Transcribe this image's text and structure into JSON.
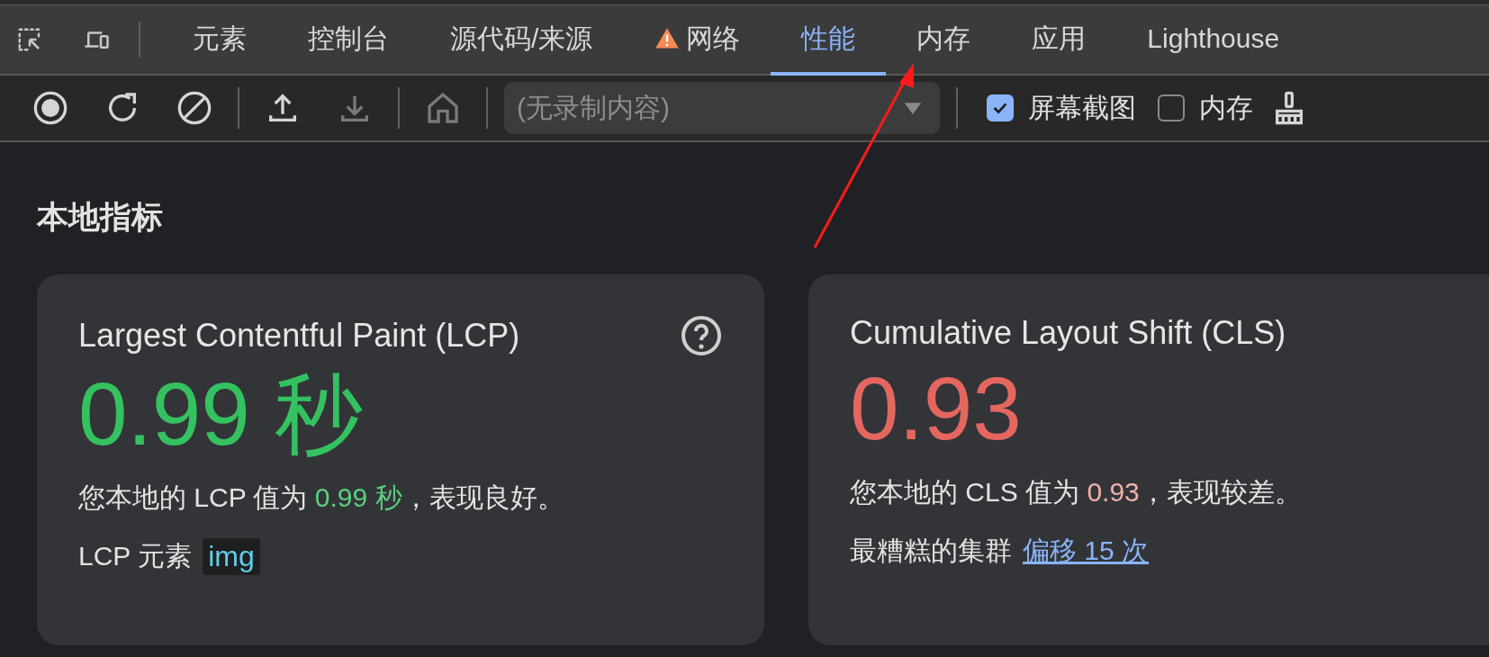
{
  "tabs": [
    {
      "label": "元素",
      "selected": false,
      "warning": false
    },
    {
      "label": "控制台",
      "selected": false,
      "warning": false
    },
    {
      "label": "源代码/来源",
      "selected": false,
      "warning": false
    },
    {
      "label": "网络",
      "selected": false,
      "warning": true
    },
    {
      "label": "性能",
      "selected": true,
      "warning": false
    },
    {
      "label": "内存",
      "selected": false,
      "warning": false
    },
    {
      "label": "应用",
      "selected": false,
      "warning": false
    },
    {
      "label": "Lighthouse",
      "selected": false,
      "warning": false
    }
  ],
  "toolbar": {
    "buttons": [
      {
        "kind": "record",
        "disabled": false
      },
      {
        "kind": "reload",
        "disabled": false
      },
      {
        "kind": "clear",
        "disabled": false
      },
      {
        "kind": "upload",
        "disabled": false
      },
      {
        "kind": "download",
        "disabled": true
      },
      {
        "kind": "home",
        "disabled": true
      }
    ],
    "recording_select": {
      "placeholder": "(无录制内容)"
    },
    "options": [
      {
        "label": "屏幕截图",
        "checked": true
      },
      {
        "label": "内存",
        "checked": false
      }
    ]
  },
  "heading": "本地指标",
  "cards": [
    {
      "title": "Largest Contentful Paint (LCP)",
      "help": true,
      "value": "0.99 秒",
      "color": "#34c260",
      "sentence": [
        {
          "text": "您本地的 LCP 值为 "
        },
        {
          "text": "0.99 秒",
          "color": "#5bd07f"
        },
        {
          "text": "，表现良好。"
        }
      ],
      "detail": {
        "label": "LCP 元素",
        "kind": "code",
        "value": "img"
      }
    },
    {
      "title": "Cumulative Layout Shift (CLS)",
      "help": false,
      "value": "0.93",
      "color": "#e4675f",
      "sentence": [
        {
          "text": "您本地的 CLS 值为 "
        },
        {
          "text": "0.93",
          "color": "#f2b0aa"
        },
        {
          "text": "，表现较差。"
        }
      ],
      "detail": {
        "label": "最糟糕的集群",
        "kind": "link",
        "value": "偏移 15 次"
      }
    }
  ]
}
